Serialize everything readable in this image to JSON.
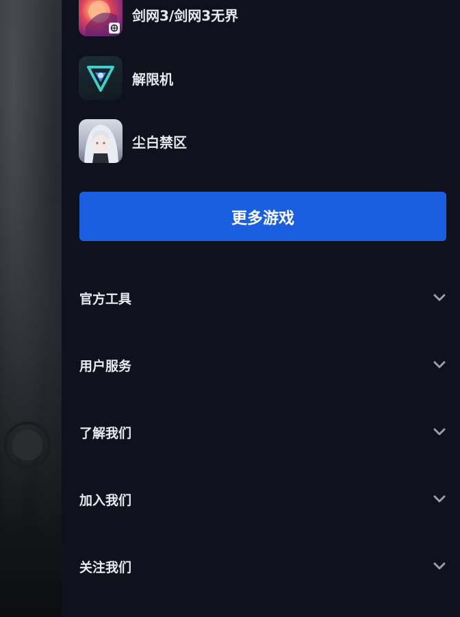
{
  "games": [
    {
      "name": "剑网3/剑网3无界",
      "icon": "jx3-game-icon"
    },
    {
      "name": "解限机",
      "icon": "mecha-break-game-icon"
    },
    {
      "name": "尘白禁区",
      "icon": "snowbreak-game-icon"
    }
  ],
  "more_games_button": "更多游戏",
  "sections": [
    {
      "label": "官方工具",
      "icon": "chevron-down-icon"
    },
    {
      "label": "用户服务",
      "icon": "chevron-down-icon"
    },
    {
      "label": "了解我们",
      "icon": "chevron-down-icon"
    },
    {
      "label": "加入我们",
      "icon": "chevron-down-icon"
    },
    {
      "label": "关注我们",
      "icon": "chevron-down-icon"
    }
  ],
  "colors": {
    "panel_bg": "#0f121c",
    "accent_blue": "#1a5fe0",
    "text": "#e8eaf0",
    "chevron": "#9aa0ab"
  }
}
